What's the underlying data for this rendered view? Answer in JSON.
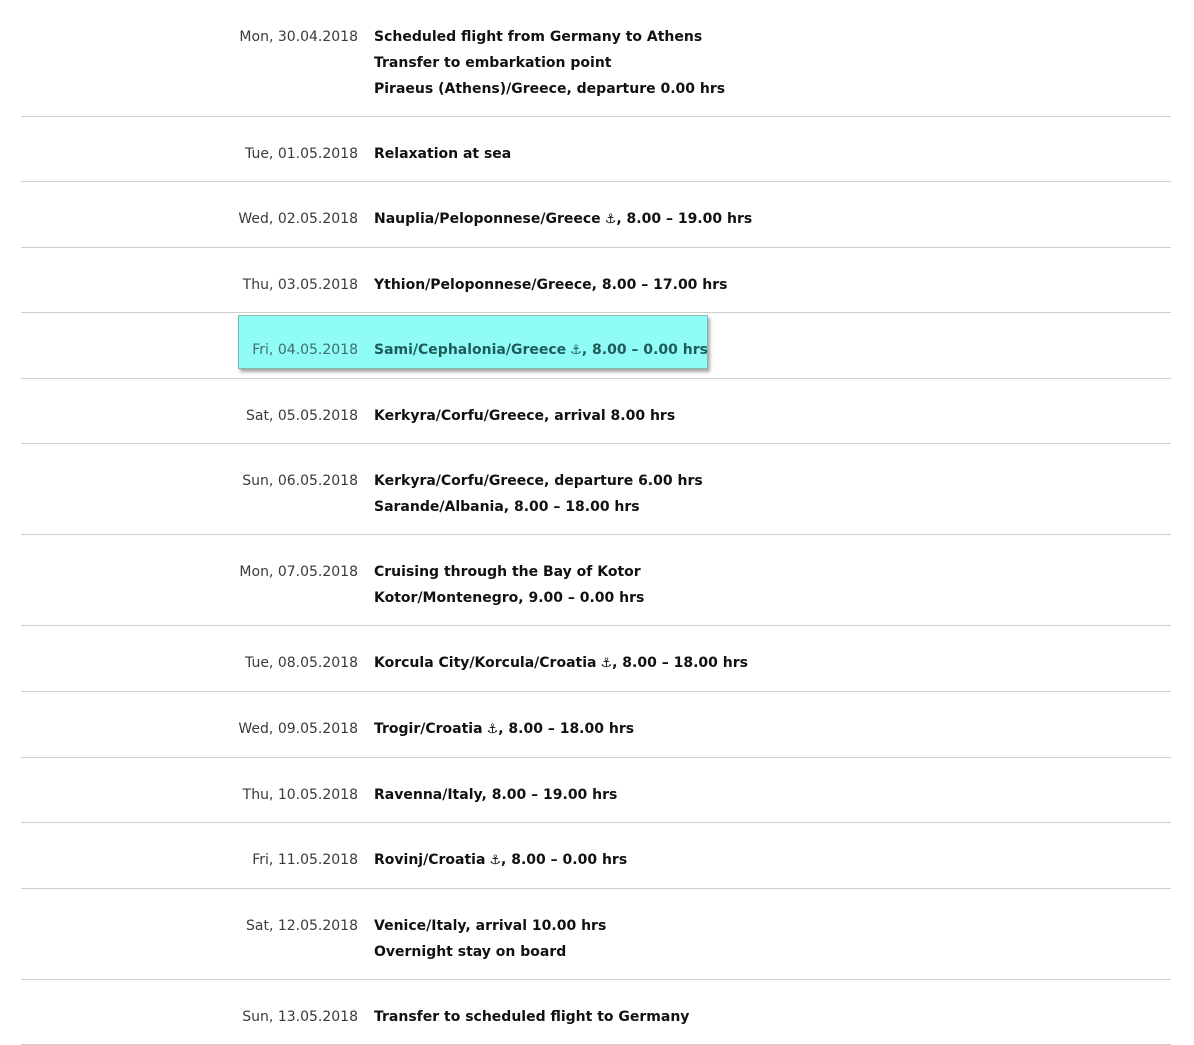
{
  "itinerary": [
    {
      "date": "Mon, 30.04.2018",
      "lines": [
        {
          "text": "Scheduled flight from Germany to Athens"
        },
        {
          "text": "Transfer to embarkation point"
        },
        {
          "text": "Piraeus (Athens)/Greece, departure 0.00 hrs"
        }
      ]
    },
    {
      "date": "Tue, 01.05.2018",
      "lines": [
        {
          "text": "Relaxation at sea"
        }
      ]
    },
    {
      "date": "Wed, 02.05.2018",
      "lines": [
        {
          "text": "Nauplia/Peloponnese/Greece",
          "anchor": true,
          "suffix": ", 8.00 – 19.00 hrs"
        }
      ]
    },
    {
      "date": "Thu, 03.05.2018",
      "lines": [
        {
          "text": "Ythion/Peloponnese/Greece, 8.00 – 17.00 hrs"
        }
      ]
    },
    {
      "date": "Fri, 04.05.2018",
      "highlighted": true,
      "lines": [
        {
          "text": "Sami/Cephalonia/Greece",
          "anchor": true,
          "suffix": ", 8.00 – 0.00 hrs"
        }
      ]
    },
    {
      "date": "Sat, 05.05.2018",
      "lines": [
        {
          "text": "Kerkyra/Corfu/Greece, arrival 8.00 hrs"
        }
      ]
    },
    {
      "date": "Sun, 06.05.2018",
      "lines": [
        {
          "text": "Kerkyra/Corfu/Greece, departure 6.00 hrs"
        },
        {
          "text": "Sarande/Albania, 8.00 – 18.00 hrs"
        }
      ]
    },
    {
      "date": "Mon, 07.05.2018",
      "lines": [
        {
          "text": "Cruising through the Bay of Kotor"
        },
        {
          "text": "Kotor/Montenegro, 9.00 – 0.00 hrs"
        }
      ]
    },
    {
      "date": "Tue, 08.05.2018",
      "lines": [
        {
          "text": "Korcula City/Korcula/Croatia",
          "anchor": true,
          "suffix": ", 8.00 – 18.00 hrs"
        }
      ]
    },
    {
      "date": "Wed, 09.05.2018",
      "lines": [
        {
          "text": "Trogir/Croatia",
          "anchor": true,
          "suffix": ", 8.00 – 18.00 hrs"
        }
      ]
    },
    {
      "date": "Thu, 10.05.2018",
      "lines": [
        {
          "text": "Ravenna/Italy, 8.00 – 19.00 hrs"
        }
      ]
    },
    {
      "date": "Fri, 11.05.2018",
      "lines": [
        {
          "text": "Rovinj/Croatia",
          "anchor": true,
          "suffix": ", 8.00 – 0.00 hrs"
        }
      ]
    },
    {
      "date": "Sat, 12.05.2018",
      "lines": [
        {
          "text": "Venice/Italy, arrival 10.00 hrs"
        },
        {
          "text": "Overnight stay on board"
        }
      ]
    },
    {
      "date": "Sun, 13.05.2018",
      "lines": [
        {
          "text": "Transfer to scheduled flight to Germany"
        }
      ]
    }
  ],
  "icons": {
    "anchor": "anchor-icon",
    "anchor_glyph": "⚓"
  },
  "colors": {
    "highlight_background": "#8ffcf6",
    "divider": "#cfcfcf"
  }
}
